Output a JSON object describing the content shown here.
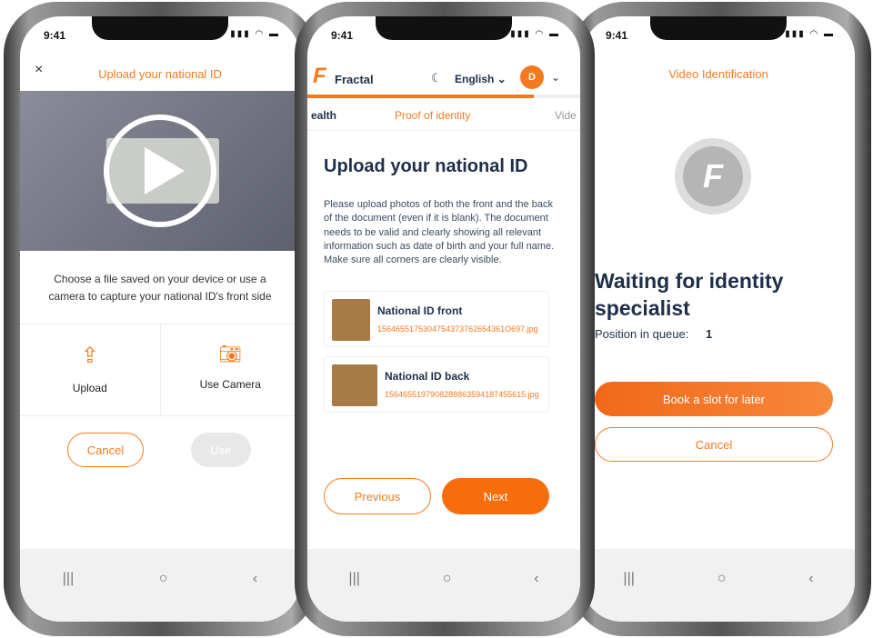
{
  "status_time": "9:41",
  "phone1": {
    "title": "Upload your national ID",
    "close_label": "×",
    "instruction": "Choose a file saved on your device or use a camera to capture your national ID's front side",
    "options": [
      {
        "label": "Upload",
        "icon": "upload-icon"
      },
      {
        "label": "Use Camera",
        "icon": "camera-icon"
      }
    ],
    "cancel_label": "Cancel",
    "use_label": "Use"
  },
  "phone2": {
    "brand": "Fractal",
    "language": "English",
    "avatar_initial": "D",
    "progress_percent": 83,
    "steps": [
      "ealth",
      "Proof of identity",
      "Vide"
    ],
    "heading": "Upload your national ID",
    "body": "Please upload photos of both the front and the back of the document (even if it is blank). The document needs to be valid and clearly showing all relevant information such as date of birth and your full name. Make sure all corners are clearly visible.",
    "files": [
      {
        "title": "National ID front",
        "filename": "1564655175304754373762654361O697.jpg"
      },
      {
        "title": "National ID back",
        "filename": "1564655197908288863594187455615.jpg"
      }
    ],
    "previous_label": "Previous",
    "next_label": "Next"
  },
  "phone3": {
    "title": "Video Identification",
    "heading": "Waiting for identity specialist",
    "queue_label": "Position in queue:",
    "queue_position": "1",
    "book_label": "Book a slot for later",
    "cancel_label": "Cancel"
  },
  "nav": {
    "recent": "|||",
    "home": "○",
    "back": "‹"
  },
  "colors": {
    "accent": "#f57a1f",
    "text": "#1e2f4a"
  }
}
